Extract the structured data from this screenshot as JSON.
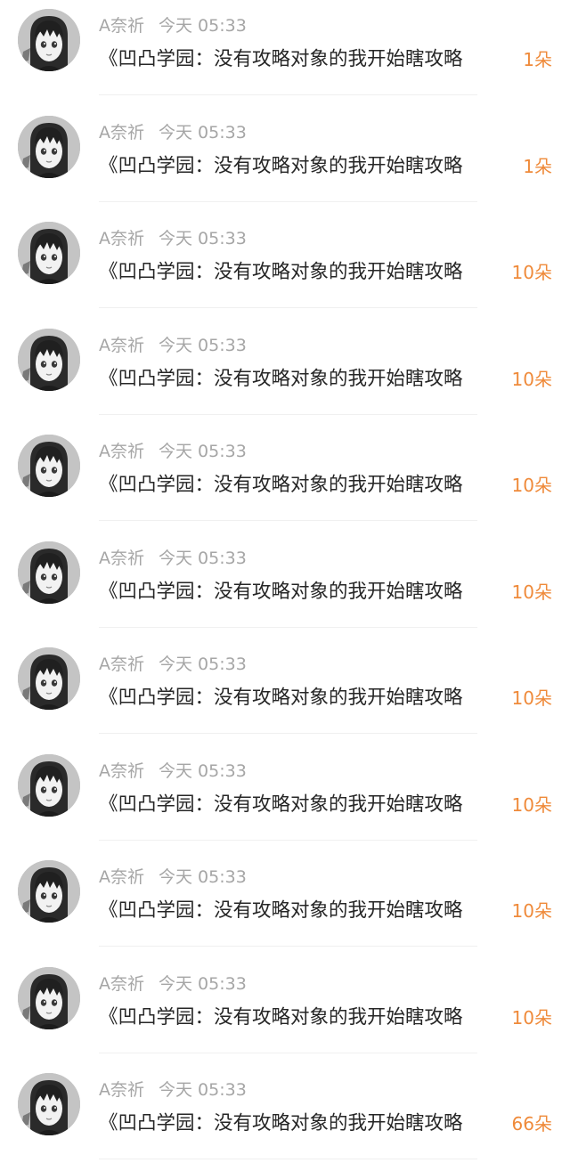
{
  "messages": [
    {
      "author": "A奈祈",
      "time": "今天 05:33",
      "text": "《凹凸学园：没有攻略对象的我开始瞎攻略",
      "flowers": "1朵"
    },
    {
      "author": "A奈祈",
      "time": "今天 05:33",
      "text": "《凹凸学园：没有攻略对象的我开始瞎攻略",
      "flowers": "1朵"
    },
    {
      "author": "A奈祈",
      "time": "今天 05:33",
      "text": "《凹凸学园：没有攻略对象的我开始瞎攻略",
      "flowers": "10朵"
    },
    {
      "author": "A奈祈",
      "time": "今天 05:33",
      "text": "《凹凸学园：没有攻略对象的我开始瞎攻略",
      "flowers": "10朵"
    },
    {
      "author": "A奈祈",
      "time": "今天 05:33",
      "text": "《凹凸学园：没有攻略对象的我开始瞎攻略",
      "flowers": "10朵"
    },
    {
      "author": "A奈祈",
      "time": "今天 05:33",
      "text": "《凹凸学园：没有攻略对象的我开始瞎攻略",
      "flowers": "10朵"
    },
    {
      "author": "A奈祈",
      "time": "今天 05:33",
      "text": "《凹凸学园：没有攻略对象的我开始瞎攻略",
      "flowers": "10朵"
    },
    {
      "author": "A奈祈",
      "time": "今天 05:33",
      "text": "《凹凸学园：没有攻略对象的我开始瞎攻略",
      "flowers": "10朵"
    },
    {
      "author": "A奈祈",
      "time": "今天 05:33",
      "text": "《凹凸学园：没有攻略对象的我开始瞎攻略",
      "flowers": "10朵"
    },
    {
      "author": "A奈祈",
      "time": "今天 05:33",
      "text": "《凹凸学园：没有攻略对象的我开始瞎攻略",
      "flowers": "10朵"
    },
    {
      "author": "A奈祈",
      "time": "今天 05:33",
      "text": "《凹凸学园：没有攻略对象的我开始瞎攻略",
      "flowers": "66朵"
    }
  ],
  "colors": {
    "meta": "#a6a6a6",
    "content": "#262626",
    "flowers": "#ef8a3a",
    "separator": "#f0f0f0"
  },
  "icons": {
    "avatar": "anime-girl-avatar"
  }
}
